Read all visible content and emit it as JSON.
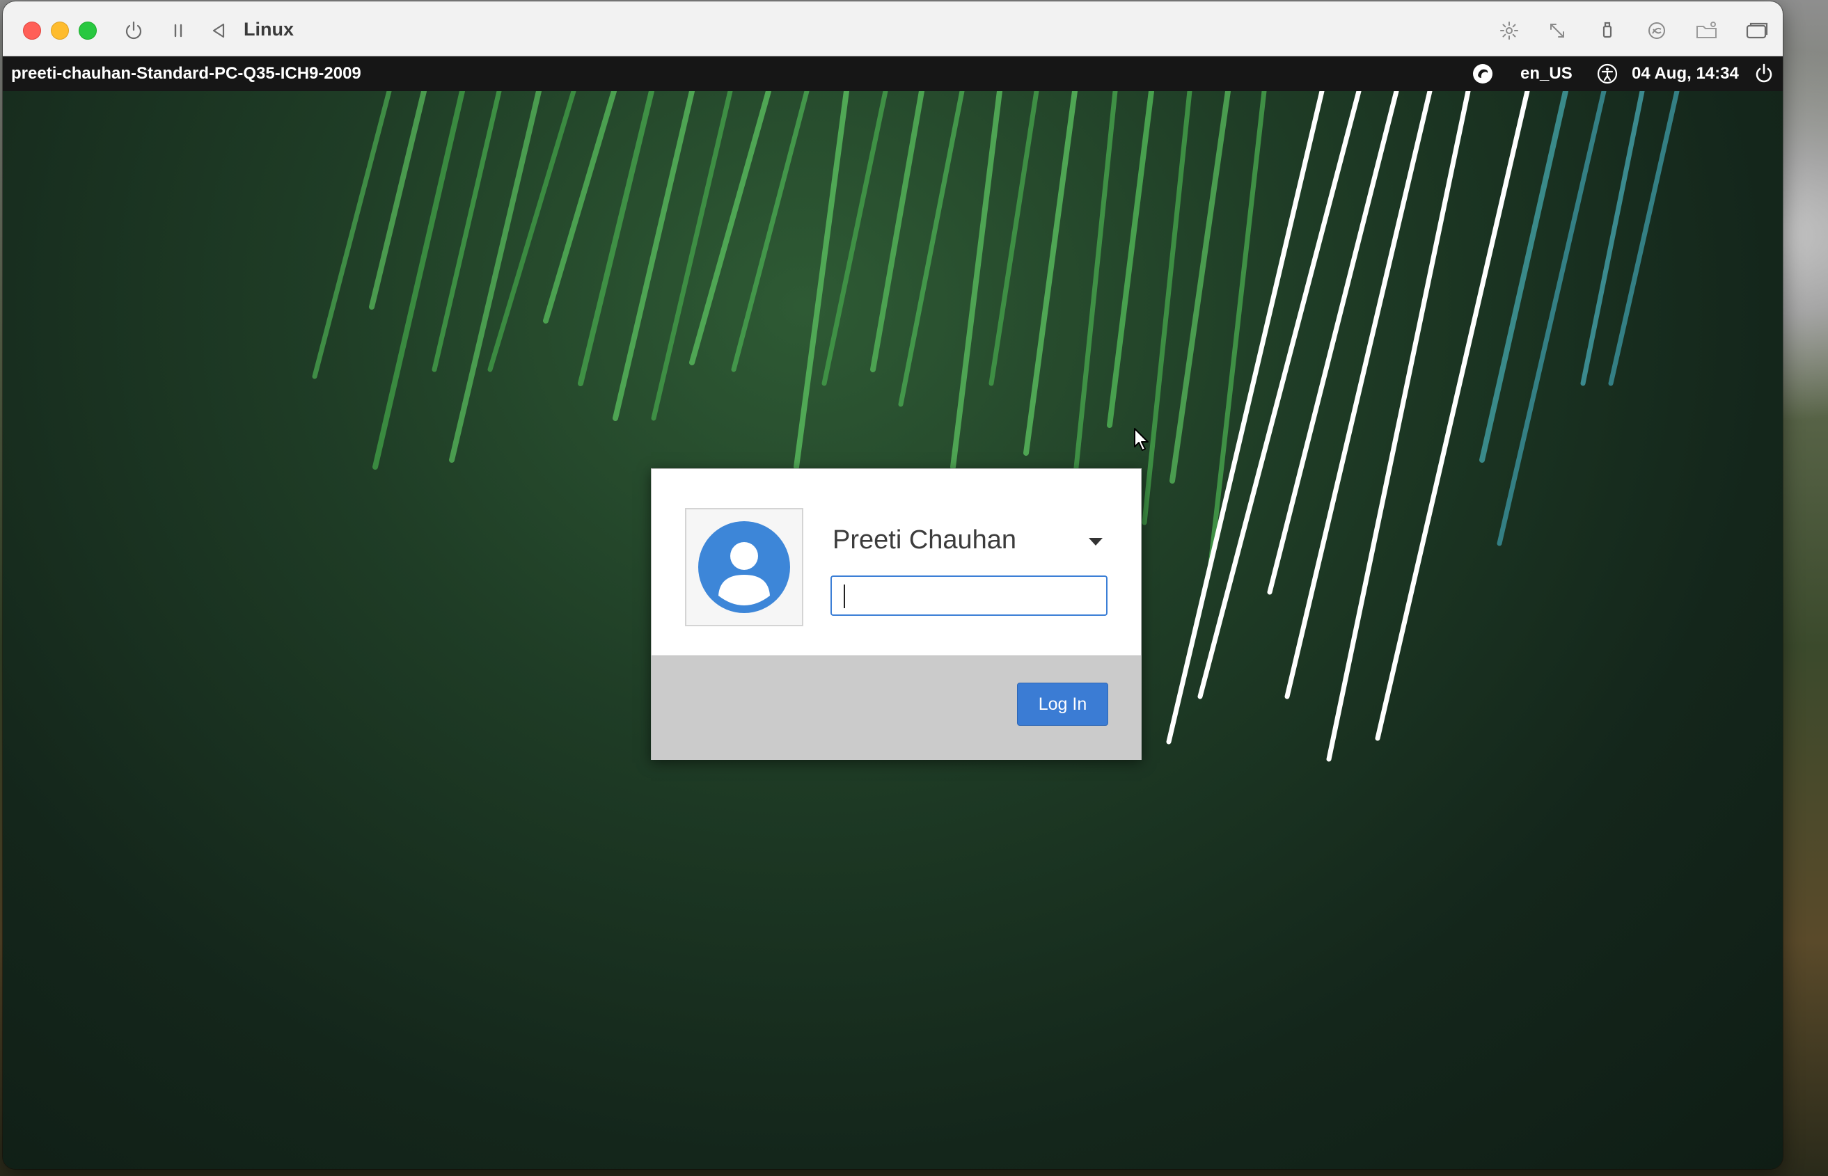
{
  "window": {
    "title": "Linux"
  },
  "panel": {
    "hostname": "preeti-chauhan-Standard-PC-Q35-ICH9-2009",
    "keyboard_layout": "en_US",
    "datetime": "04 Aug, 14:34"
  },
  "login": {
    "username": "Preeti Chauhan",
    "password_value": "",
    "login_label": "Log In"
  },
  "colors": {
    "accent": "#3b7cd4",
    "panel_bg": "#161616",
    "titlebar_bg": "#f2f2f2"
  }
}
